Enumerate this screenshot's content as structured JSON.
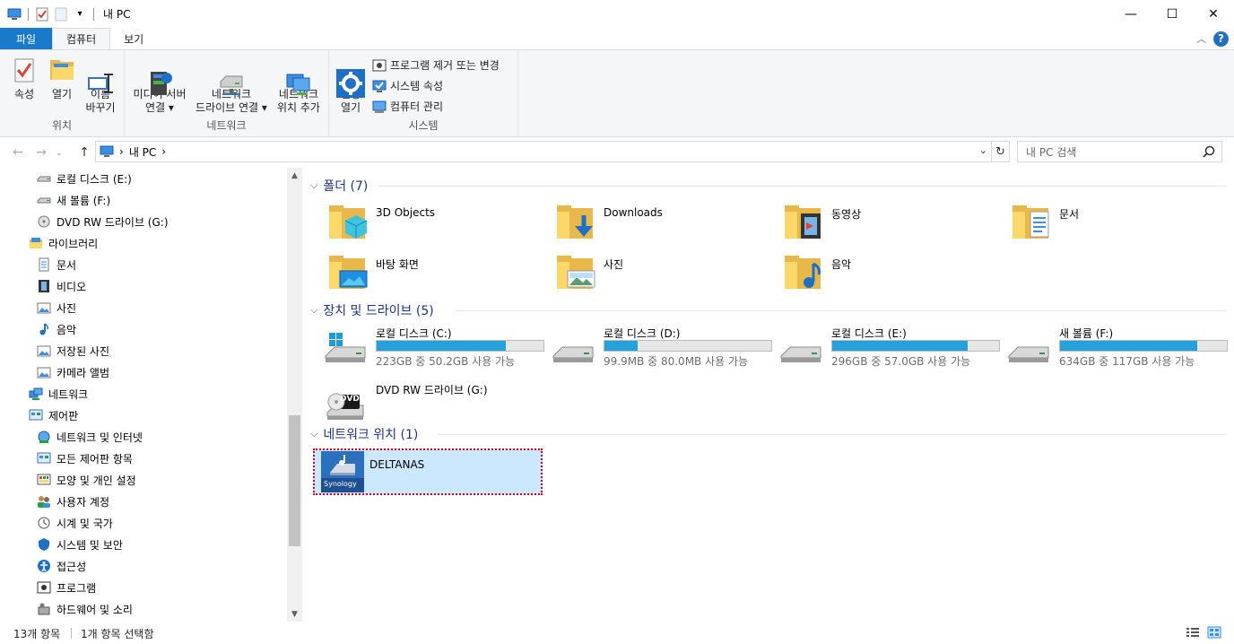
{
  "window": {
    "title": "내 PC",
    "controls": {
      "minimize": "—",
      "maximize": "☐",
      "close": "✕"
    }
  },
  "qat": {
    "dropdown": "▾"
  },
  "tabs": [
    {
      "label": "파일"
    },
    {
      "label": "컴퓨터"
    },
    {
      "label": "보기"
    }
  ],
  "ribbon": {
    "location_group": {
      "label": "위치",
      "properties": "속성",
      "open": "열기",
      "rename": "이름\n바꾸기"
    },
    "network_group": {
      "label": "네트워크",
      "media_server": "미디어 서버\n연결 ▾",
      "map_drive": "네트워크\n드라이브 연결 ▾",
      "add_location": "네트워크\n위치 추가"
    },
    "system_group": {
      "label": "시스템",
      "open_settings": "설정\n열기",
      "uninstall": "프로그램 제거 또는 변경",
      "system_props": "시스템 속성",
      "manage": "컴퓨터 관리"
    }
  },
  "address": {
    "path": "내 PC",
    "separator": "›",
    "search_placeholder": "내 PC 검색"
  },
  "sidebar": {
    "items": [
      {
        "label": "로컬 디스크 (E:)",
        "icon": "drive-icon",
        "level": 2
      },
      {
        "label": "새 볼륨 (F:)",
        "icon": "drive-icon",
        "level": 2
      },
      {
        "label": "DVD RW 드라이브 (G:)",
        "icon": "dvd-icon",
        "level": 2
      },
      {
        "label": "라이브러리",
        "icon": "library-icon",
        "level": 1
      },
      {
        "label": "문서",
        "icon": "document-icon",
        "level": 2
      },
      {
        "label": "비디오",
        "icon": "video-icon",
        "level": 2
      },
      {
        "label": "사진",
        "icon": "picture-icon",
        "level": 2
      },
      {
        "label": "음악",
        "icon": "music-icon",
        "level": 2
      },
      {
        "label": "저장된 사진",
        "icon": "picture-icon",
        "level": 2
      },
      {
        "label": "카메라 앨범",
        "icon": "picture-icon",
        "level": 2
      },
      {
        "label": "네트워크",
        "icon": "network-icon",
        "level": 1
      },
      {
        "label": "제어판",
        "icon": "control-panel-icon",
        "level": 1
      },
      {
        "label": "네트워크 및 인터넷",
        "icon": "network-internet-icon",
        "level": 2
      },
      {
        "label": "모든 제어판 항목",
        "icon": "control-panel-icon",
        "level": 2
      },
      {
        "label": "모양 및 개인 설정",
        "icon": "appearance-icon",
        "level": 2
      },
      {
        "label": "사용자 계정",
        "icon": "users-icon",
        "level": 2
      },
      {
        "label": "시계 및 국가",
        "icon": "clock-icon",
        "level": 2
      },
      {
        "label": "시스템 및 보안",
        "icon": "shield-icon",
        "level": 2
      },
      {
        "label": "접근성",
        "icon": "accessibility-icon",
        "level": 2
      },
      {
        "label": "프로그램",
        "icon": "programs-icon",
        "level": 2
      },
      {
        "label": "하드웨어 및 소리",
        "icon": "hardware-icon",
        "level": 2
      }
    ]
  },
  "content": {
    "folders_header": "폴더 (7)",
    "folders": [
      {
        "label": "3D Objects",
        "overlay": "cube"
      },
      {
        "label": "Downloads",
        "overlay": "download"
      },
      {
        "label": "동영상",
        "overlay": "film"
      },
      {
        "label": "문서",
        "overlay": "doc"
      },
      {
        "label": "바탕 화면",
        "overlay": "desktop"
      },
      {
        "label": "사진",
        "overlay": "photo"
      },
      {
        "label": "음악",
        "overlay": "music"
      }
    ],
    "drives_header": "장치 및 드라이브 (5)",
    "drives": [
      {
        "label": "로컬 디스크 (C:)",
        "info": "223GB 중 50.2GB 사용 가능",
        "used": 0.775,
        "system": true
      },
      {
        "label": "로컬 디스크 (D:)",
        "info": "99.9MB 중 80.0MB 사용 가능",
        "used": 0.2,
        "system": false
      },
      {
        "label": "로컬 디스크 (E:)",
        "info": "296GB 중 57.0GB 사용 가능",
        "used": 0.81,
        "system": false
      },
      {
        "label": "새 볼륨 (F:)",
        "info": "634GB 중 117GB 사용 가능",
        "used": 0.82,
        "system": false
      }
    ],
    "dvd": {
      "label": "DVD RW 드라이브 (G:)",
      "badge": "DVD"
    },
    "network_header": "네트워크 위치 (1)",
    "nas": {
      "label": "DELTANAS",
      "brand": "Synology"
    }
  },
  "status": {
    "count": "13개 항목",
    "selected": "1개 항목 선택함"
  },
  "colors": {
    "accent": "#1979ca",
    "header_text": "#1e3287",
    "bar_fill": "#26a0da",
    "selection": "#cce8ff",
    "selection_border": "#d0021b"
  }
}
